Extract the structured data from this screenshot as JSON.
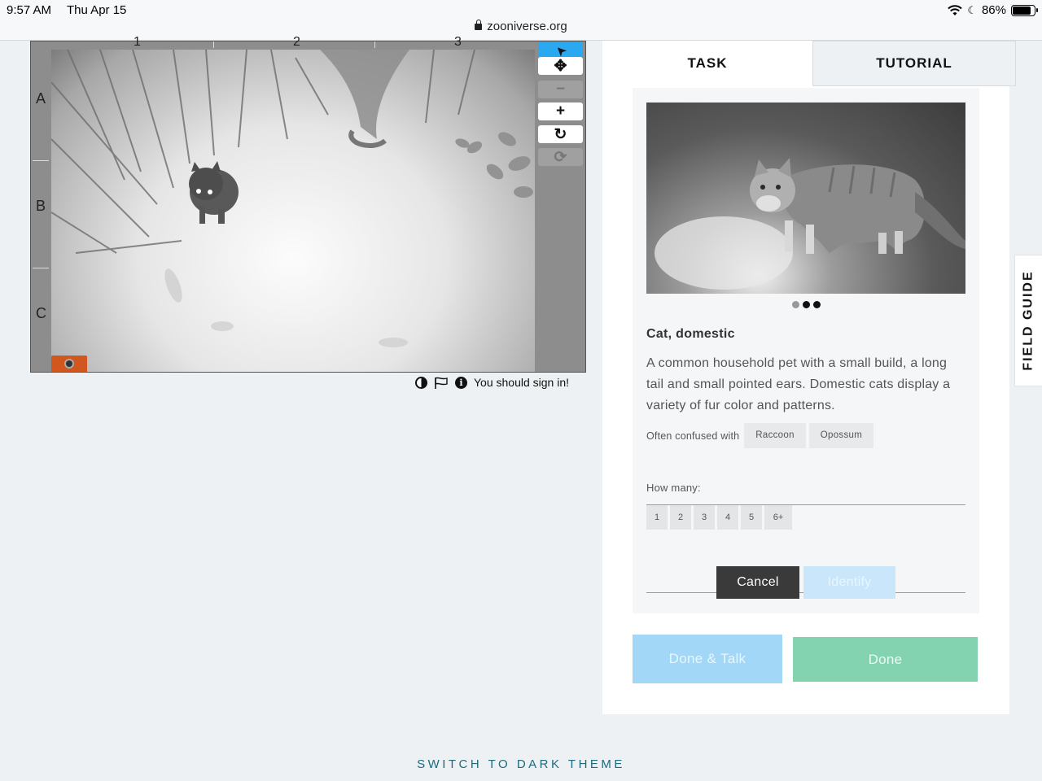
{
  "status_bar": {
    "time": "9:57 AM",
    "date": "Thu Apr 15",
    "battery_percent": "86%",
    "battery_level": 0.86,
    "url": "zooniverse.org"
  },
  "viewer": {
    "column_labels": [
      "1",
      "2",
      "3"
    ],
    "row_labels": [
      "A",
      "B",
      "C"
    ],
    "tools": [
      {
        "name": "pointer-tool",
        "icon": "pointer-icon",
        "glyph": "➤",
        "state": "active"
      },
      {
        "name": "move-tool",
        "icon": "move-icon",
        "glyph": "✥",
        "state": "normal"
      },
      {
        "name": "zoom-out-tool",
        "icon": "minus-icon",
        "glyph": "−",
        "state": "disabled"
      },
      {
        "name": "zoom-in-tool",
        "icon": "plus-icon",
        "glyph": "+",
        "state": "normal"
      },
      {
        "name": "rotate-tool",
        "icon": "rotate-icon",
        "glyph": "↻",
        "state": "normal"
      },
      {
        "name": "reset-tool",
        "icon": "reset-icon",
        "glyph": "⟳",
        "state": "disabled"
      }
    ],
    "footer": {
      "sign_in_text": "You should sign in!"
    }
  },
  "panel": {
    "tabs": {
      "task": "TASK",
      "tutorial": "TUTORIAL"
    },
    "species": {
      "name": "Cat, domestic",
      "description": "A common household pet with a small build, a long tail and small pointed ears. Domestic cats display a variety of fur color and patterns.",
      "confused_label": "Often confused with",
      "confused_with": [
        "Raccoon",
        "Opossum"
      ],
      "image_dots": 3,
      "active_dot": 1
    },
    "how_many_label": "How many:",
    "counts": [
      "1",
      "2",
      "3",
      "4",
      "5",
      "6+"
    ],
    "cancel_label": "Cancel",
    "identify_label": "Identify",
    "done_talk_label": "Done & Talk",
    "done_label": "Done"
  },
  "field_guide_label": "FIELD GUIDE",
  "theme_switch_label": "SWITCH TO DARK THEME",
  "colors": {
    "accent_blue": "#2aa8f0",
    "done_green": "#84d3b0",
    "done_talk_blue": "#a2d7f7",
    "theme_link": "#1e6a7d"
  }
}
